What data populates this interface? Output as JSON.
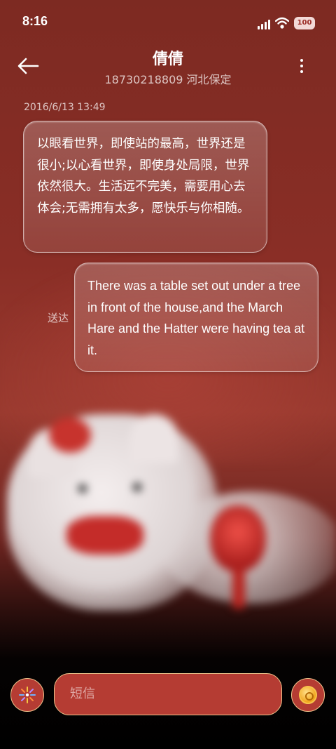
{
  "status_bar": {
    "time": "8:16",
    "battery": "100"
  },
  "header": {
    "contact_name": "倩倩",
    "contact_detail": "18730218809 河北保定"
  },
  "conversation": {
    "timestamp": "2016/6/13 13:49",
    "messages": [
      {
        "direction": "incoming",
        "text": "以眼看世界，即使站的最高，世界还是很小;以心看世界，即使身处局限，世界依然很大。生活远不完美，需要用心去体会;无需拥有太多，愿快乐与你相随。"
      },
      {
        "direction": "outgoing",
        "status": "送达",
        "text": "There was a table set out under a tree in front of the house,and the March Hare and the Hatter were having tea at it."
      }
    ]
  },
  "composer": {
    "placeholder": "短信"
  },
  "icons": {
    "back": "back-arrow-icon",
    "more": "more-vertical-icon",
    "attach": "sparkle-icon",
    "send": "coin-icon"
  },
  "colors": {
    "accent_border": "#f0c48c",
    "button_fill": "#b53c33",
    "background_red": "#8a2e26"
  }
}
